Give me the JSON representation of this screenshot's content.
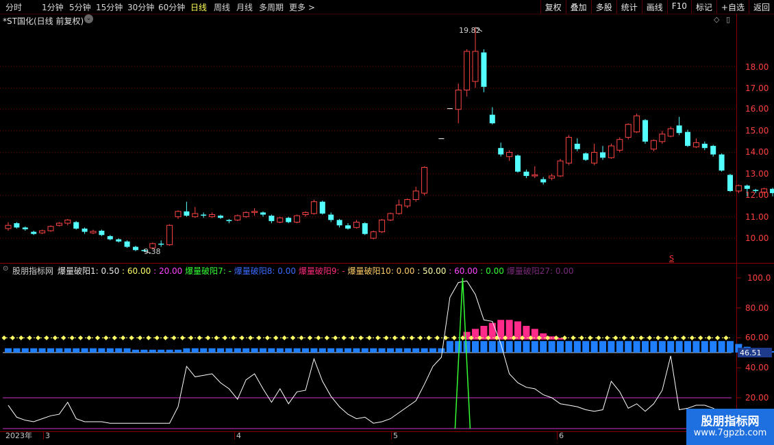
{
  "toolbar": {
    "items": [
      "分时",
      "1分钟",
      "5分钟",
      "15分钟",
      "30分钟",
      "60分钟",
      "日线",
      "周线",
      "月线",
      "多周期",
      "更多 >"
    ],
    "active": "日线",
    "right": [
      "复权",
      "叠加",
      "多股",
      "统计",
      "画线",
      "F10",
      "标记",
      "+自选",
      "返回"
    ]
  },
  "main": {
    "title": "*ST国化(日线 前复权)",
    "price_ticks": [
      "18.00",
      "17.00",
      "16.00",
      "15.00",
      "14.00",
      "13.00",
      "12.00",
      "11.00",
      "10.00"
    ],
    "high_label": "19.82",
    "low_label": "9.38",
    "s_marker": "S"
  },
  "indicator": {
    "name": "股朋指标网",
    "segments": [
      {
        "text": "爆量破阳1: 0.50",
        "color": "#e8e8e8"
      },
      {
        "text": ": 60.00",
        "color": "#ffff66"
      },
      {
        "text": ": 20.00",
        "color": "#ff44ff"
      },
      {
        "text": "爆量破阳7: -",
        "color": "#33ff33"
      },
      {
        "text": "爆量破阳8: 0.00",
        "color": "#3a6bff"
      },
      {
        "text": "爆量破阳9: -",
        "color": "#ff2a7a"
      },
      {
        "text": "爆量破阳10: 0.00",
        "color": "#ffcc66"
      },
      {
        "text": ": 50.00",
        "color": "#ffffaa"
      },
      {
        "text": ": 60.00",
        "color": "#ff44ff"
      },
      {
        "text": ": 0.00",
        "color": "#33ff33"
      },
      {
        "text": "爆量破阳27: 0.00",
        "color": "#7a2a7a"
      }
    ],
    "ticks": [
      "100.0",
      "80.00",
      "60.00",
      "40.00",
      "20.00"
    ],
    "current_value": "46.51"
  },
  "x_axis": {
    "labels": [
      "2023年",
      "3",
      "4",
      "5",
      "6"
    ]
  },
  "watermark": {
    "title": "股朋指标网",
    "url": "www.7gpzb.com"
  },
  "chart_data": {
    "type": "candlestick",
    "title": "*ST国化(日线 前复权)",
    "candles": [
      [
        10.45,
        10.6,
        10.35,
        10.75
      ],
      [
        10.7,
        10.5,
        10.45,
        10.75
      ],
      [
        10.5,
        10.42,
        10.35,
        10.55
      ],
      [
        10.3,
        10.2,
        10.15,
        10.35
      ],
      [
        10.25,
        10.35,
        10.2,
        10.4
      ],
      [
        10.35,
        10.55,
        10.3,
        10.6
      ],
      [
        10.6,
        10.7,
        10.55,
        10.75
      ],
      [
        10.7,
        10.85,
        10.6,
        10.9
      ],
      [
        10.75,
        10.45,
        10.4,
        10.8
      ],
      [
        10.45,
        10.3,
        10.2,
        10.5
      ],
      [
        10.25,
        10.32,
        10.2,
        10.4
      ],
      [
        10.35,
        10.15,
        10.1,
        10.4
      ],
      [
        10.1,
        9.95,
        9.9,
        10.15
      ],
      [
        9.95,
        9.85,
        9.8,
        10.0
      ],
      [
        9.85,
        9.6,
        9.55,
        9.9
      ],
      [
        9.6,
        9.45,
        9.4,
        9.65
      ],
      [
        9.45,
        9.4,
        9.38,
        9.5
      ],
      [
        9.55,
        9.75,
        9.5,
        9.8
      ],
      [
        9.75,
        9.7,
        9.6,
        9.9
      ],
      [
        9.7,
        10.6,
        9.65,
        10.65
      ],
      [
        11.0,
        11.25,
        10.9,
        11.3
      ],
      [
        11.25,
        11.05,
        11.0,
        11.7
      ],
      [
        11.0,
        11.15,
        10.95,
        11.45
      ],
      [
        11.1,
        11.05,
        10.95,
        11.2
      ],
      [
        11.0,
        11.1,
        10.95,
        11.2
      ],
      [
        11.05,
        10.95,
        10.9,
        11.1
      ],
      [
        10.85,
        10.8,
        10.7,
        10.9
      ],
      [
        10.85,
        11.05,
        10.8,
        11.1
      ],
      [
        11.0,
        11.2,
        10.95,
        11.25
      ],
      [
        11.2,
        11.25,
        11.05,
        11.4
      ],
      [
        11.2,
        11.1,
        11.0,
        11.25
      ],
      [
        11.05,
        10.8,
        10.7,
        11.1
      ],
      [
        10.75,
        10.95,
        10.7,
        11.0
      ],
      [
        10.95,
        10.75,
        10.7,
        11.0
      ],
      [
        10.75,
        11.05,
        10.7,
        11.1
      ],
      [
        11.1,
        11.2,
        11.0,
        11.25
      ],
      [
        11.15,
        11.7,
        11.1,
        11.8
      ],
      [
        11.7,
        11.15,
        11.1,
        11.75
      ],
      [
        11.1,
        10.85,
        10.75,
        11.2
      ],
      [
        10.85,
        10.6,
        10.5,
        10.9
      ],
      [
        10.6,
        10.45,
        10.4,
        10.7
      ],
      [
        10.5,
        10.75,
        10.45,
        10.85
      ],
      [
        10.7,
        10.2,
        10.15,
        10.75
      ],
      [
        10.0,
        10.3,
        9.95,
        10.35
      ],
      [
        10.3,
        10.85,
        10.25,
        10.9
      ],
      [
        10.85,
        11.15,
        10.8,
        11.2
      ],
      [
        11.15,
        11.55,
        11.1,
        11.8
      ],
      [
        11.5,
        11.8,
        11.4,
        11.85
      ],
      [
        11.8,
        12.2,
        11.7,
        12.4
      ],
      [
        12.1,
        13.3,
        12.0,
        13.35
      ],
      [
        null,
        null,
        null,
        null
      ],
      [
        14.65,
        14.65,
        14.65,
        14.65
      ],
      [
        16.05,
        16.05,
        16.05,
        16.05
      ],
      [
        16.0,
        16.9,
        15.35,
        17.2
      ],
      [
        16.9,
        18.7,
        16.6,
        18.8
      ],
      [
        17.3,
        18.7,
        17.0,
        19.82
      ],
      [
        18.65,
        17.05,
        16.8,
        18.8
      ],
      [
        15.75,
        15.35,
        15.3,
        16.1
      ],
      [
        14.2,
        13.9,
        13.8,
        14.45
      ],
      [
        13.8,
        14.0,
        13.6,
        14.1
      ],
      [
        13.85,
        13.1,
        13.05,
        13.9
      ],
      [
        13.1,
        12.9,
        12.8,
        13.2
      ],
      [
        12.9,
        12.95,
        12.8,
        13.35
      ],
      [
        12.75,
        12.6,
        12.5,
        12.85
      ],
      [
        12.8,
        12.9,
        12.7,
        13.0
      ],
      [
        12.9,
        13.6,
        12.85,
        13.7
      ],
      [
        13.5,
        14.7,
        13.4,
        14.8
      ],
      [
        14.4,
        14.15,
        14.05,
        14.65
      ],
      [
        13.95,
        13.65,
        13.6,
        14.0
      ],
      [
        13.5,
        14.0,
        13.4,
        14.4
      ],
      [
        14.0,
        13.75,
        13.65,
        14.3
      ],
      [
        13.75,
        14.3,
        13.7,
        14.4
      ],
      [
        14.1,
        14.6,
        14.0,
        14.7
      ],
      [
        14.7,
        15.3,
        14.6,
        15.35
      ],
      [
        14.95,
        15.7,
        14.9,
        15.8
      ],
      [
        15.5,
        14.5,
        14.4,
        15.55
      ],
      [
        14.15,
        14.55,
        14.05,
        14.6
      ],
      [
        14.5,
        14.85,
        14.4,
        15.0
      ],
      [
        14.75,
        15.1,
        14.7,
        15.2
      ],
      [
        15.25,
        14.9,
        14.8,
        15.65
      ],
      [
        14.95,
        14.3,
        14.25,
        15.05
      ],
      [
        14.25,
        14.45,
        14.2,
        14.65
      ],
      [
        14.4,
        14.2,
        14.1,
        14.5
      ],
      [
        14.3,
        13.9,
        13.8,
        14.35
      ],
      [
        13.9,
        13.15,
        13.1,
        13.95
      ],
      [
        12.95,
        12.2,
        12.15,
        13.0
      ],
      [
        12.2,
        12.45,
        12.1,
        12.5
      ],
      [
        12.45,
        12.3,
        11.95,
        12.5
      ],
      [
        12.25,
        12.2,
        12.1,
        12.3
      ],
      [
        12.15,
        12.3,
        12.1,
        12.35
      ],
      [
        12.3,
        12.1,
        11.95,
        12.35
      ],
      [
        12.1,
        12.05,
        12.0,
        12.15
      ]
    ],
    "ylim": [
      9.0,
      20.5
    ],
    "indicator_line": [
      15,
      7,
      5,
      4,
      6,
      8,
      9,
      17,
      6,
      4,
      4,
      4,
      3,
      3,
      3,
      3,
      3,
      3,
      3,
      3,
      14,
      41,
      34,
      35,
      36,
      30,
      26,
      19,
      32,
      36,
      26,
      17,
      26,
      16,
      24,
      25,
      46,
      31,
      21,
      14,
      9,
      6,
      7,
      3,
      4,
      6,
      10,
      14,
      18,
      29,
      41,
      47,
      87,
      97,
      98,
      89,
      72,
      71,
      56,
      36,
      30,
      27,
      26,
      22,
      20,
      16,
      15,
      14,
      12,
      11,
      12,
      31,
      24,
      13,
      16,
      11,
      16,
      25,
      48,
      12,
      13,
      15,
      15,
      13,
      10,
      10,
      9,
      8,
      7,
      6,
      6
    ],
    "green_spike": [
      53,
      54
    ],
    "blue_bars": [
      3,
      3,
      3,
      3,
      3,
      3,
      3,
      3,
      3,
      3,
      3,
      3,
      3,
      3,
      3,
      2,
      2,
      2,
      2,
      2,
      2,
      3,
      3,
      3,
      3,
      3,
      3,
      3,
      3,
      3,
      3,
      3,
      3,
      3,
      3,
      3,
      3,
      3,
      3,
      3,
      3,
      3,
      3,
      3,
      3,
      3,
      3,
      3,
      3,
      3,
      3,
      3,
      8,
      8,
      8,
      8,
      8,
      8,
      8,
      8,
      8,
      8,
      8,
      8,
      8,
      8,
      8,
      8,
      8,
      8,
      8,
      8,
      8,
      8,
      8,
      8,
      8,
      8,
      8,
      8,
      8,
      8,
      8,
      8,
      8,
      8,
      6,
      4,
      2,
      1,
      1
    ],
    "pink_bars": [
      0,
      0,
      0,
      0,
      0,
      0,
      0,
      0,
      0,
      0,
      0,
      0,
      0,
      0,
      0,
      0,
      0,
      0,
      0,
      0,
      0,
      0,
      0,
      0,
      0,
      0,
      0,
      0,
      0,
      0,
      0,
      0,
      0,
      0,
      0,
      0,
      0,
      0,
      0,
      0,
      0,
      0,
      0,
      0,
      0,
      0,
      0,
      0,
      0,
      0,
      0,
      0,
      0,
      0,
      64,
      66,
      68,
      70,
      72,
      72,
      71,
      68,
      66,
      63,
      61,
      60,
      0,
      0,
      0,
      0,
      0,
      0,
      0,
      0,
      0,
      0,
      0,
      0,
      0,
      0,
      0,
      0,
      0,
      0,
      0,
      0,
      0,
      0,
      0,
      0,
      0
    ],
    "indicator_ylim": [
      0,
      105
    ],
    "hlines": {
      "yellow": 60,
      "purple": 20
    }
  }
}
